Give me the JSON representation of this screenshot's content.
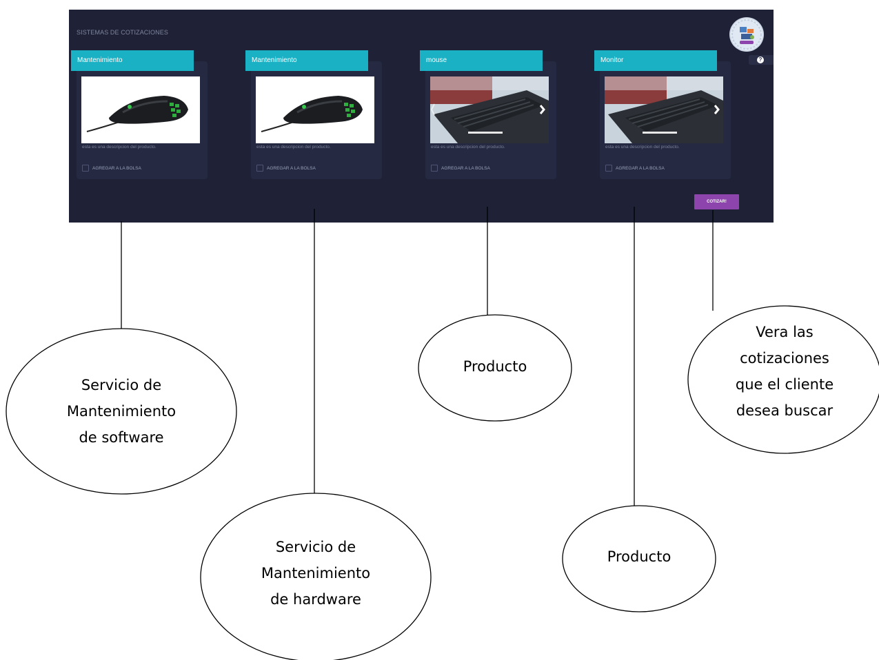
{
  "app": {
    "title": "SISTEMAS DE COTIZACIONES",
    "help_icon": "?",
    "logo": "company-logo"
  },
  "cards": [
    {
      "title": "Mantenimiento",
      "image": "gaming-mouse",
      "description": "esta es una descripcion del producto.",
      "checkbox_label": "AGREGAR A LA BOLSA",
      "checked": false
    },
    {
      "title": "Mantenimiento",
      "image": "gaming-mouse",
      "description": "esta es una descripcion del producto.",
      "checkbox_label": "AGREGAR A LA BOLSA",
      "checked": false
    },
    {
      "title": "mouse",
      "image": "laptop-carousel",
      "description": "esta es una descripcion del producto.",
      "checkbox_label": "AGREGAR A LA BOLSA",
      "checked": false
    },
    {
      "title": "Monitor",
      "image": "laptop-carousel",
      "description": "esta es una descripcion del producto.",
      "checkbox_label": "AGREGAR A LA BOLSA",
      "checked": false
    }
  ],
  "cotizar_button": "COTIZAR!",
  "annotations": [
    {
      "text": "Servicio de\nMantenimiento\nde software"
    },
    {
      "text": "Servicio de\nMantenimiento\nde hardware"
    },
    {
      "text": "Producto"
    },
    {
      "text": "Producto"
    },
    {
      "text": "Vera las\ncotizaciones\nque el cliente\ndesea buscar"
    }
  ]
}
